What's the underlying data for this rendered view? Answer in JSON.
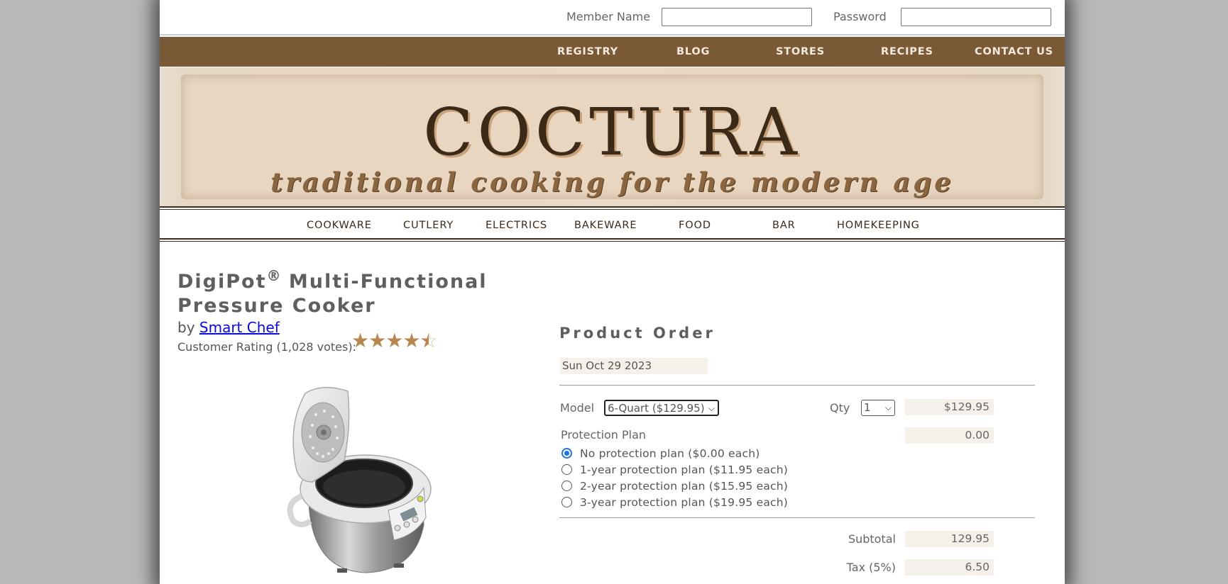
{
  "login": {
    "member_label": "Member Name",
    "password_label": "Password",
    "member_value": "",
    "password_value": ""
  },
  "top_nav": [
    "REGISTRY",
    "BLOG",
    "STORES",
    "RECIPES",
    "CONTACT US"
  ],
  "banner": {
    "logo": "COCTURA",
    "tagline": "traditional cooking for the modern age"
  },
  "categories": [
    "COOKWARE",
    "CUTLERY",
    "ELECTRICS",
    "BAKEWARE",
    "FOOD",
    "BAR",
    "HOMEKEEPING"
  ],
  "product": {
    "title_part1": "DigiPot",
    "title_mark": "®",
    "title_part2": " Multi-Functional Pressure Cooker",
    "by_label": "by ",
    "brand": "Smart Chef",
    "rating_label": "Customer Rating (1,028 votes):",
    "rating_value": 4.5,
    "rating_max": 5
  },
  "order": {
    "heading": "Product Order",
    "date": "Sun Oct 29 2023",
    "model_label": "Model",
    "model_selected": "6-Quart ($129.95)",
    "qty_label": "Qty",
    "qty_selected": "1",
    "line_amount": "$129.95",
    "protection_label": "Protection Plan",
    "protection_amount": "0.00",
    "protection_options": [
      "No protection plan ($0.00 each)",
      "1-year protection plan ($11.95 each)",
      "2-year protection plan ($15.95 each)",
      "3-year protection plan ($19.95 each)"
    ],
    "protection_selected_index": 0,
    "subtotal_label": "Subtotal",
    "subtotal_value": "129.95",
    "tax_label": "Tax (5%)",
    "tax_value": "6.50"
  },
  "colors": {
    "nav_brown": "#7a5a36",
    "logo_dark": "#3c2a19",
    "star_gold": "#b88750",
    "link_blue": "#0a0ae0",
    "radio_blue": "#1a73e8"
  }
}
